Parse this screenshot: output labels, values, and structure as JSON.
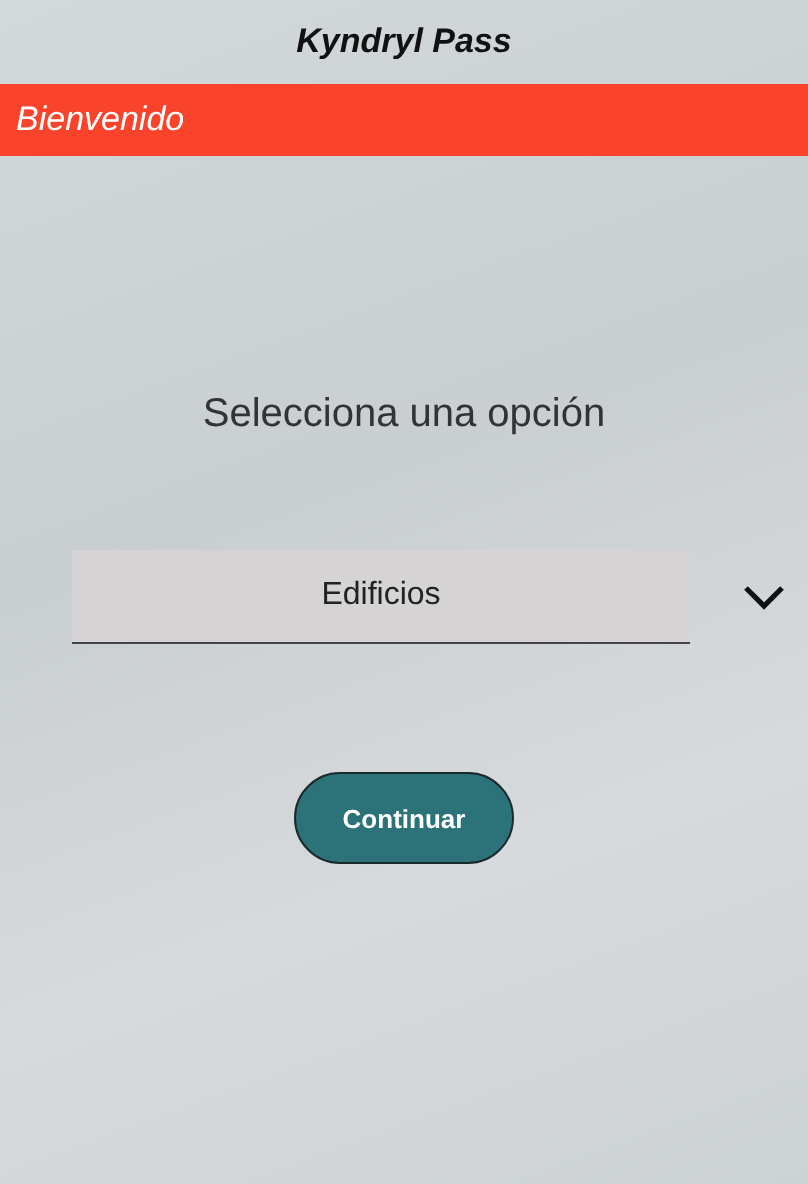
{
  "window": {
    "title": "Kyndryl Pass"
  },
  "banner": {
    "text": "Bienvenido"
  },
  "prompt": "Selecciona una opción",
  "select": {
    "value": "Edificios"
  },
  "buttons": [
    {
      "label": "Continuar"
    }
  ]
}
